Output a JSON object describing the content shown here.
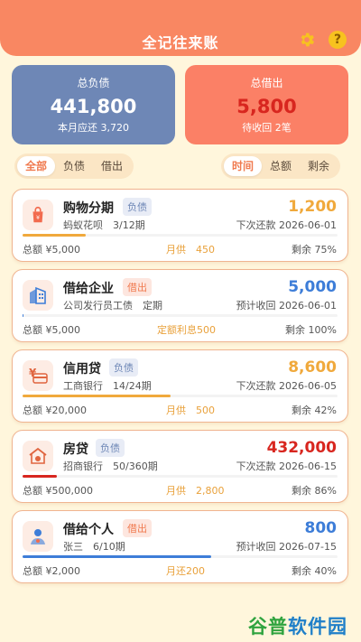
{
  "header": {
    "title": "全记往来账",
    "settings_icon": "gear-icon",
    "help_icon": "help-icon",
    "help_glyph": "?"
  },
  "summary": {
    "debt": {
      "label": "总负债",
      "value": "441,800",
      "sub": "本月应还 3,720"
    },
    "lend": {
      "label": "总借出",
      "value": "5,800",
      "sub": "待收回 2笔"
    }
  },
  "filters": {
    "type": [
      "全部",
      "负债",
      "借出"
    ],
    "type_active": 0,
    "sort": [
      "时间",
      "总额",
      "剩余"
    ],
    "sort_active": 0
  },
  "colors": {
    "orange": "#F0A93C",
    "blue": "#3D7DD8",
    "red": "#D8261F",
    "debt_badge": "#6E87B6",
    "lend_badge": "#F07A4F"
  },
  "records": [
    {
      "icon": "shopping-bag-icon",
      "name": "购物分期",
      "badge": "负债",
      "badge_type": "debt",
      "amount": "1,200",
      "amount_color": "#F0A93C",
      "desc": "蚂蚁花呗　3/12期",
      "next": "下次还款 2026-06-01",
      "progress": 0.2,
      "bar_color": "#F0A93C",
      "total": "总额 ¥5,000",
      "mid": "月供　450",
      "remain": "剩余 75%"
    },
    {
      "icon": "building-icon",
      "name": "借给企业",
      "badge": "借出",
      "badge_type": "lend",
      "amount": "5,000",
      "amount_color": "#3D7DD8",
      "desc": "公司发行员工债　定期",
      "next": "预计收回 2026-06-01",
      "progress": 0.0,
      "bar_color": "#3D7DD8",
      "total": "总额 ¥5,000",
      "mid": "定额利息500",
      "remain": "剩余 100%"
    },
    {
      "icon": "card-yen-icon",
      "name": "信用贷",
      "badge": "负债",
      "badge_type": "debt",
      "amount": "8,600",
      "amount_color": "#F0A93C",
      "desc": "工商银行　14/24期",
      "next": "下次还款 2026-06-05",
      "progress": 0.47,
      "bar_color": "#F0A93C",
      "total": "总额 ¥20,000",
      "mid": "月供　500",
      "remain": "剩余 42%"
    },
    {
      "icon": "house-icon",
      "name": "房贷",
      "badge": "负债",
      "badge_type": "debt",
      "amount": "432,000",
      "amount_color": "#D8261F",
      "desc": "招商银行　50/360期",
      "next": "下次还款 2026-06-15",
      "progress": 0.11,
      "bar_color": "#D8261F",
      "total": "总额 ¥500,000",
      "mid": "月供　2,800",
      "remain": "剩余 86%"
    },
    {
      "icon": "person-icon",
      "name": "借给个人",
      "badge": "借出",
      "badge_type": "lend",
      "amount": "800",
      "amount_color": "#3D7DD8",
      "desc": "张三　6/10期",
      "next": "预计收回 2026-07-15",
      "progress": 0.6,
      "bar_color": "#3D7DD8",
      "total": "总额 ¥2,000",
      "mid": "月还200",
      "remain": "剩余 40%"
    }
  ],
  "watermark": {
    "part1": "谷普",
    "part2": "软件园"
  }
}
